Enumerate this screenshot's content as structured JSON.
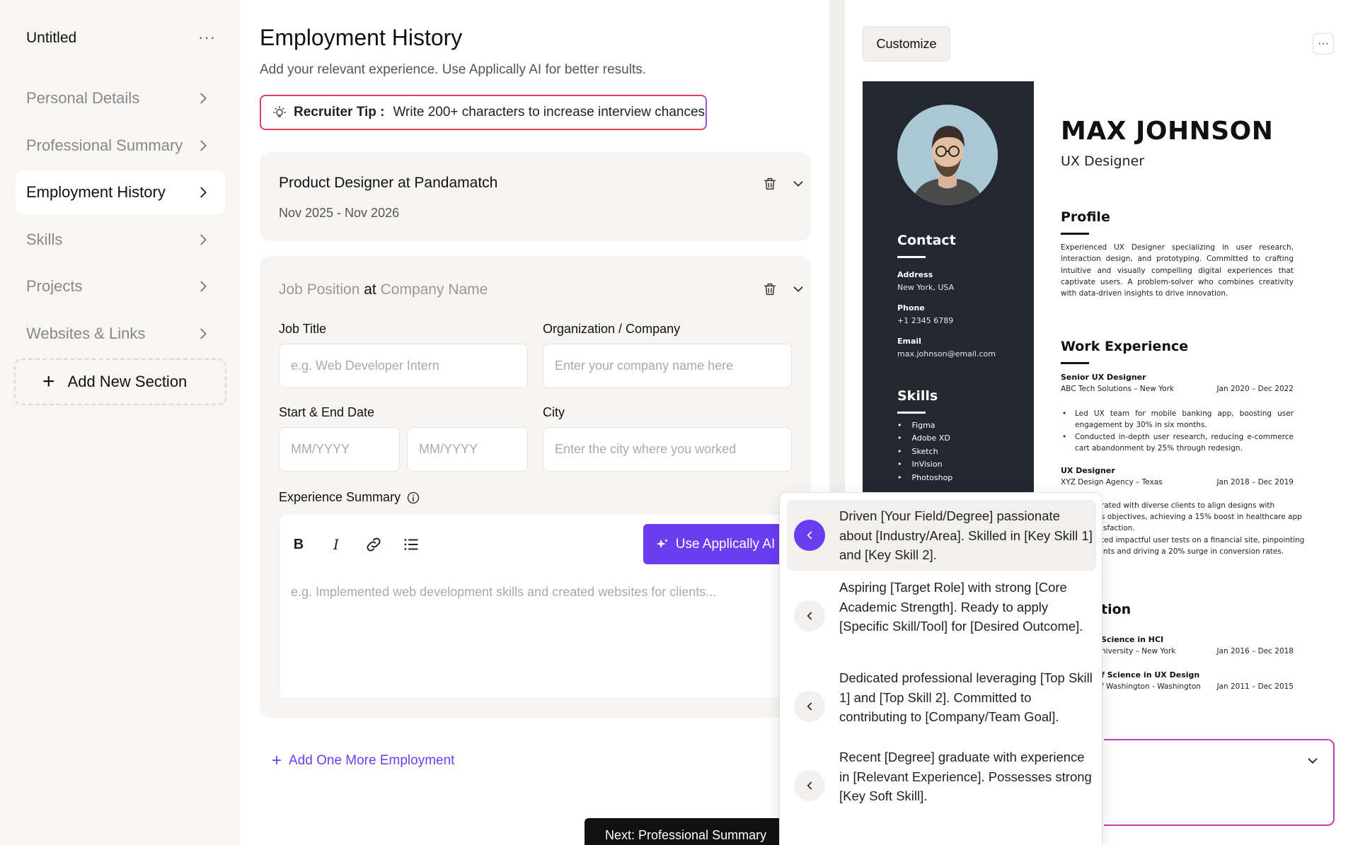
{
  "sidebar": {
    "doc_title": "Untitled",
    "menu_glyph": "···",
    "items": [
      {
        "label": "Personal Details"
      },
      {
        "label": "Professional Summary"
      },
      {
        "label": "Employment History"
      },
      {
        "label": "Skills"
      },
      {
        "label": "Projects"
      },
      {
        "label": "Websites & Links"
      }
    ],
    "active_index": 2,
    "add_section": "Add New Section"
  },
  "editor": {
    "title": "Employment History",
    "subtitle": "Add your relevant experience. Use Applically AI for better results.",
    "tip": {
      "label": "Recruiter Tip :",
      "text": "Write 200+ characters to increase interview chances"
    },
    "saved_entry": {
      "title": "Product Designer at Pandamatch",
      "dates": "Nov 2025 - Nov 2026"
    },
    "new_entry": {
      "position": "Job Position",
      "at": "at",
      "company": "Company Name",
      "job_title_label": "Job Title",
      "job_title_placeholder": "e.g. Web Developer Intern",
      "org_label": "Organization / Company",
      "org_placeholder": "Enter your company name here",
      "dates_label": "Start & End Date",
      "start_placeholder": "MM/YYYY",
      "end_placeholder": "MM/YYYY",
      "city_label": "City",
      "city_placeholder": "Enter the city where you worked",
      "summary_label": "Experience Summary",
      "ai_button": "Use Applically AI",
      "summary_placeholder": "e.g. Implemented web development skills and created websites for clients..."
    },
    "add_more": "Add One More Employment",
    "next_button": "Next: Professional Summary"
  },
  "ai_suggestions": [
    "Driven [Your Field/Degree] passionate about [Industry/Area]. Skilled in [Key Skill 1] and [Key Skill 2].",
    "Aspiring [Target Role] with strong [Core Academic Strength]. Ready to apply [Specific Skill/Tool] for [Desired Outcome].",
    "Dedicated professional leveraging [Top Skill 1] and [Top Skill 2]. Committed to contributing to [Company/Team Goal].",
    "Recent [Degree] graduate with experience in [Relevant Experience]. Possesses strong [Key Soft Skill]."
  ],
  "preview": {
    "customize": "Customize",
    "menu_glyph": "···",
    "resume": {
      "name": "MAX JOHNSON",
      "role": "UX Designer",
      "contact_heading": "Contact",
      "address_label": "Address",
      "address": "New York, USA",
      "phone_label": "Phone",
      "phone": "+1 2345 6789",
      "email_label": "Email",
      "email": "max.johnson@email.com",
      "skills_heading": "Skills",
      "skills": [
        "Figma",
        "Adobe XD",
        "Sketch",
        "InVision",
        "Photoshop"
      ],
      "profile_heading": "Profile",
      "profile": "Experienced UX Designer specializing in user research, interaction design, and prototyping. Committed to crafting intuitive and visually compelling digital experiences that captivate users. A problem-solver who combines creativity with data-driven insights to drive innovation.",
      "work_heading": "Work Experience",
      "job1": {
        "title": "Senior UX Designer",
        "company": "ABC Tech Solutions – New York",
        "dates": "Jan 2020 – Dec 2022",
        "bullets": [
          "Led UX team for mobile banking app, boosting user engagement by 30% in six months.",
          "Conducted in-depth user research, reducing e-commerce cart abandonment by 25% through redesign."
        ]
      },
      "job2": {
        "title": "UX Designer",
        "company": "XYZ Design Agency – Texas",
        "dates": "Jan 2018 – Dec 2019",
        "partial_lines": [
          "rated with diverse clients to align designs with",
          "s objectives, achieving a 15% boost in healthcare app",
          "isfaction.",
          "ted impactful user tests on a financial site, pinpointing",
          "ints and driving a 20% surge in conversion rates."
        ]
      },
      "education_heading_partial": "tion",
      "edu1": {
        "degree": "Science in HCI",
        "school": "niversity – New York",
        "dates": "Jan 2016 – Dec 2018"
      },
      "edu2": {
        "degree": "f Science in UX Design",
        "school": "f Washington - Washington",
        "dates": "Jan 2011 – Dec 2015"
      }
    }
  },
  "colors": {
    "accent": "#6a3df0",
    "sidebar_bg": "#f7f6f4",
    "card_bg": "#f6f5f3",
    "resume_sidebar": "#232830",
    "tip_border_start": "#e3405a",
    "tip_border_end": "#8e5bdc"
  }
}
